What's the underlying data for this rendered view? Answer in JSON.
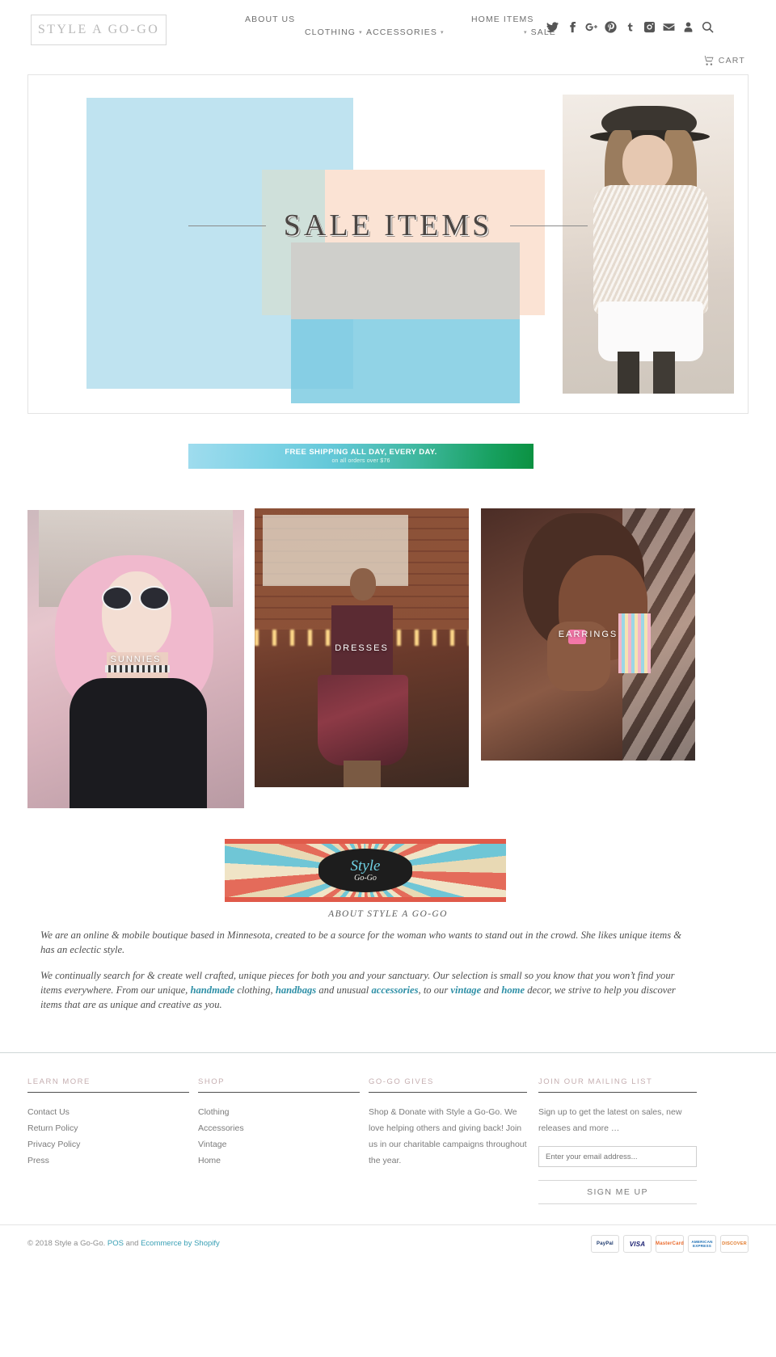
{
  "header": {
    "logo": "STYLE A GO-GO",
    "nav": [
      {
        "label": "ABOUT US",
        "caret": false
      },
      {
        "label": "CLOTHING",
        "caret": true
      },
      {
        "label": "ACCESSORIES",
        "caret": true
      },
      {
        "label": "HOME ITEMS",
        "caret": true
      },
      {
        "label": "SALE",
        "caret": false
      }
    ],
    "caret_glyph": "▾",
    "social": [
      {
        "name": "twitter-icon"
      },
      {
        "name": "facebook-icon"
      },
      {
        "name": "google-plus-icon"
      },
      {
        "name": "pinterest-icon"
      },
      {
        "name": "tumblr-icon"
      },
      {
        "name": "instagram-icon"
      },
      {
        "name": "email-icon"
      },
      {
        "name": "account-icon"
      },
      {
        "name": "search-icon"
      }
    ],
    "cart_label": "CART"
  },
  "hero": {
    "title": "SALE ITEMS"
  },
  "shipping_banner": {
    "headline": "FREE SHIPPING ALL DAY, EVERY DAY.",
    "subline": "on all orders over $76"
  },
  "tiles": [
    {
      "label": "SUNNIES"
    },
    {
      "label": "DRESSES"
    },
    {
      "label": "EARRINGS"
    }
  ],
  "about": {
    "logo_line1": "Style",
    "logo_line2": "Go-Go",
    "heading": "ABOUT STYLE A GO-GO",
    "paragraph1": "We are an online & mobile boutique based in Minnesota, created to be a source for the woman who wants to stand out in the crowd. She likes unique items & has an eclectic style.",
    "p2_a": "We continually search for & create well crafted, unique pieces for both you and your sanctuary. Our selection is small so you know that you won’t find your items everywhere. From our unique, ",
    "p2_link1": "handmade",
    "p2_b": " clothing, ",
    "p2_link2": "handbags",
    "p2_c": " and unusual ",
    "p2_link3": "accessories",
    "p2_d": ", to our ",
    "p2_link4": "vintage",
    "p2_e": " and ",
    "p2_link5": "home",
    "p2_f": " decor, we strive to help you discover items that are as unique and creative as you."
  },
  "footer": {
    "columns": [
      {
        "title": "LEARN MORE",
        "links": [
          "Contact Us",
          "Return Policy",
          "Privacy Policy",
          "Press"
        ]
      },
      {
        "title": "SHOP",
        "links": [
          "Clothing",
          "Accessories",
          "Vintage",
          "Home"
        ]
      }
    ],
    "gives": {
      "title": "GO-GO GIVES",
      "text": "Shop & Donate with Style a Go-Go. We love helping others and giving back! Join us in our charitable campaigns throughout the year."
    },
    "mailing": {
      "title": "JOIN OUR MAILING LIST",
      "text": "Sign up to get the latest on sales, new releases and more …",
      "placeholder": "Enter your email address...",
      "value": "",
      "button": "SIGN ME UP"
    }
  },
  "copyright": {
    "prefix": "© 2018 Style a Go-Go. ",
    "pos": "POS",
    "mid": " and ",
    "shopify": "Ecommerce by Shopify",
    "payments": [
      {
        "name": "paypal-icon",
        "label": "PayPal"
      },
      {
        "name": "visa-icon",
        "label": "VISA"
      },
      {
        "name": "mastercard-icon",
        "label": "MasterCard"
      },
      {
        "name": "amex-icon",
        "label": "AMERICAN EXPRESS"
      },
      {
        "name": "discover-icon",
        "label": "DISCOVER"
      }
    ]
  },
  "colors": {
    "accent": "#2e8fa6",
    "banner_start": "#9fdcee",
    "banner_end": "#0b9141",
    "footer_heading": "#c5aeb0"
  }
}
